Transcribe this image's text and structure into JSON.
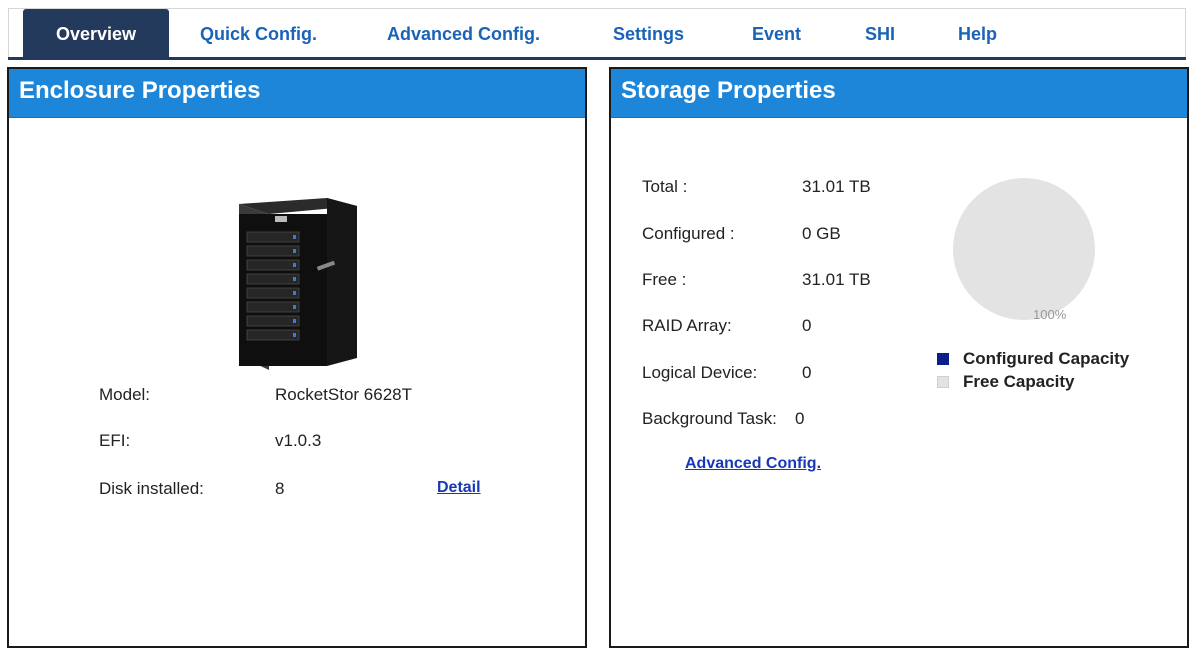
{
  "nav": {
    "tabs": [
      {
        "label": "Overview",
        "active": true
      },
      {
        "label": "Quick Config."
      },
      {
        "label": "Advanced Config."
      },
      {
        "label": "Settings"
      },
      {
        "label": "Event"
      },
      {
        "label": "SHI"
      },
      {
        "label": "Help"
      }
    ]
  },
  "enclosure": {
    "title": "Enclosure Properties",
    "model_label": "Model:",
    "model_value": "RocketStor 6628T",
    "efi_label": "EFI:",
    "efi_value": "v1.0.3",
    "disk_label": "Disk installed:",
    "disk_value": "8",
    "detail_link": "Detail"
  },
  "storage": {
    "title": "Storage Properties",
    "rows": [
      {
        "label": "Total :",
        "value": "31.01 TB"
      },
      {
        "label": "Configured :",
        "value": "0 GB"
      },
      {
        "label": "Free :",
        "value": "31.01 TB"
      },
      {
        "label": "RAID Array:",
        "value": "0"
      },
      {
        "label": "Logical Device:",
        "value": "0"
      },
      {
        "label": "Background Task:",
        "value": "0"
      }
    ],
    "advanced_link": "Advanced Config.",
    "pie_percent_label": "100%",
    "legend_configured": "Configured Capacity",
    "legend_free": "Free Capacity",
    "free_fraction": 1.0
  },
  "colors": {
    "header_blue": "#1e86d9",
    "nav_dark": "#243a5c",
    "link_blue": "#1739b7",
    "configured": "#0b1f8a",
    "free": "#e3e3e3"
  }
}
